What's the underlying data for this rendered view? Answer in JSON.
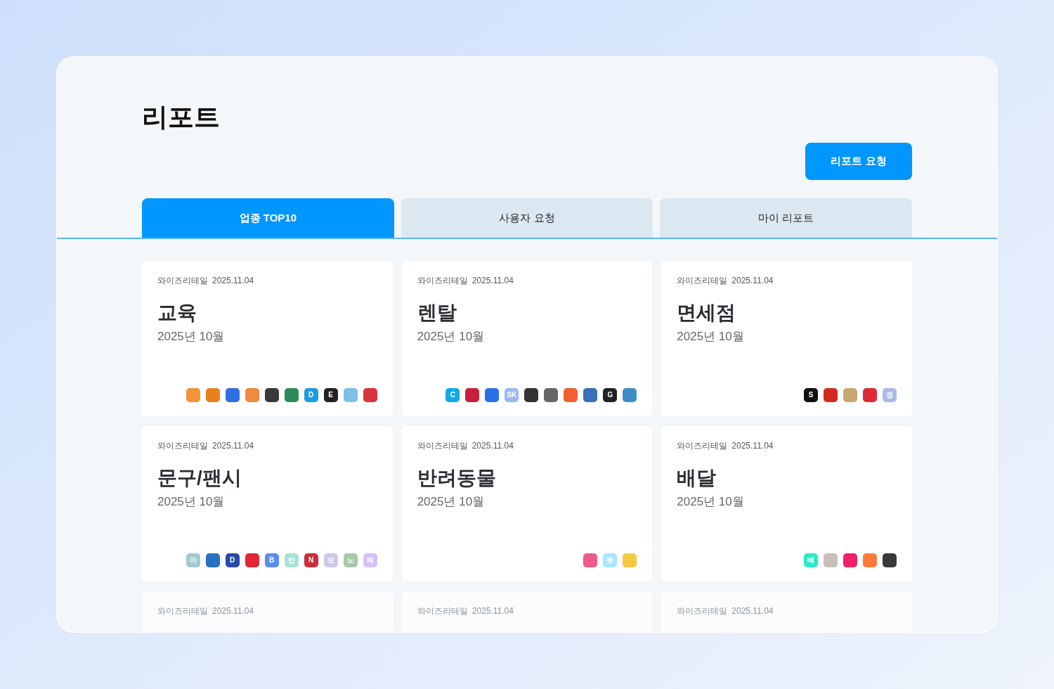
{
  "page_title": "리포트",
  "request_button": "리포트 요청",
  "tabs": [
    {
      "label": "업종 TOP10",
      "selected": true
    },
    {
      "label": "사용자 요청",
      "selected": false
    },
    {
      "label": "마이 리포트",
      "selected": false
    }
  ],
  "cards": [
    {
      "kind": "full",
      "source": "와이즈리테일",
      "date": "2025.11.04",
      "title": "교육",
      "period": "2025년 10월",
      "logos": [
        {
          "color": "#f5923a"
        },
        {
          "color": "#e8801c"
        },
        {
          "color": "#2f6fe0"
        },
        {
          "color": "#f08a3c"
        },
        {
          "color": "#3a3a3a"
        },
        {
          "color": "#2e8b57"
        },
        {
          "color": "#1a9ce0",
          "text": "D"
        },
        {
          "color": "#222222",
          "text": "E"
        },
        {
          "color": "#7cc0e8"
        },
        {
          "color": "#d8343c"
        }
      ]
    },
    {
      "kind": "full",
      "source": "와이즈리테일",
      "date": "2025.11.04",
      "title": "렌탈",
      "period": "2025년 10월",
      "logos": [
        {
          "color": "#13a8e8",
          "text": "C"
        },
        {
          "color": "#c8203c"
        },
        {
          "color": "#2a70e8"
        },
        {
          "color": "#9ab8f5",
          "text": "SK"
        },
        {
          "color": "#333333"
        },
        {
          "color": "#666666"
        },
        {
          "color": "#f06030"
        },
        {
          "color": "#3a70b8"
        },
        {
          "color": "#222222",
          "text": "G"
        },
        {
          "color": "#3f8cc8"
        }
      ]
    },
    {
      "kind": "full",
      "source": "와이즈리테일",
      "date": "2025.11.04",
      "title": "면세점",
      "period": "2025년 10월",
      "logos": [
        {
          "color": "#111111",
          "text": "S"
        },
        {
          "color": "#d42a20"
        },
        {
          "color": "#c8a870"
        },
        {
          "color": "#e02a3a"
        },
        {
          "color": "#a8bce6",
          "text": "경"
        }
      ]
    },
    {
      "kind": "full",
      "source": "와이즈리테일",
      "date": "2025.11.04",
      "title": "문구/팬시",
      "period": "2025년 10월",
      "logos": [
        {
          "color": "#a3c8d0",
          "text": "아"
        },
        {
          "color": "#2a70c0"
        },
        {
          "color": "#2a4aa8",
          "text": "D"
        },
        {
          "color": "#e02838"
        },
        {
          "color": "#5a8ef0",
          "text": "B"
        },
        {
          "color": "#a8e0d8",
          "text": "반"
        },
        {
          "color": "#c8303a",
          "text": "N"
        },
        {
          "color": "#d0c8e8",
          "text": "모"
        },
        {
          "color": "#a9c9a9",
          "text": "노"
        },
        {
          "color": "#d4c0f5",
          "text": "페"
        }
      ]
    },
    {
      "kind": "full",
      "source": "와이즈리테일",
      "date": "2025.11.04",
      "title": "반려동물",
      "period": "2025년 10월",
      "logos": [
        {
          "color": "#f05a88"
        },
        {
          "color": "#a8e4ff",
          "text": "펫"
        },
        {
          "color": "#f5c840"
        }
      ]
    },
    {
      "kind": "full",
      "source": "와이즈리테일",
      "date": "2025.11.04",
      "title": "배달",
      "period": "2025년 10월",
      "logos": [
        {
          "color": "#2ee8c8",
          "text": "배"
        },
        {
          "color": "#c8c0b8"
        },
        {
          "color": "#f02068"
        },
        {
          "color": "#ff7a3a"
        },
        {
          "color": "#3a3a3a"
        }
      ]
    },
    {
      "kind": "cut",
      "source": "와이즈리테일",
      "date": "2025.11.04"
    },
    {
      "kind": "cut",
      "source": "와이즈리테일",
      "date": "2025.11.04"
    },
    {
      "kind": "cut",
      "source": "와이즈리테일",
      "date": "2025.11.04"
    }
  ]
}
